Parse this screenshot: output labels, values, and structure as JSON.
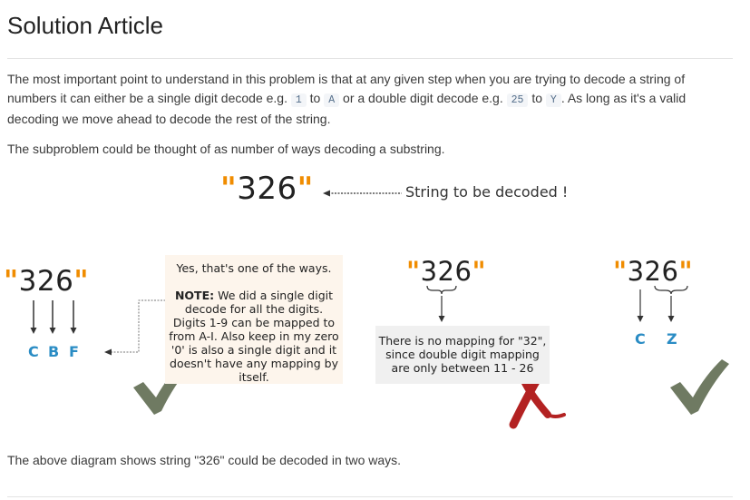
{
  "title": "Solution Article",
  "intro": {
    "text_a": "The most important point to understand in this problem is that at any given step when you are trying to decode a string of numbers it can either be a single digit decode e.g. ",
    "code_1": "1",
    "to_1": " to ",
    "code_2": "A",
    "text_b": " or a double digit decode e.g. ",
    "code_3": "25",
    "to_2": " to ",
    "code_4": "Y",
    "text_c": ". As long as it's a valid decoding we move ahead to decode the rest of the string."
  },
  "subproblem_text": "The subproblem could be thought of as number of ways decoding a substring.",
  "diagram": {
    "input_string": "326",
    "input_caption": "String to be decoded !",
    "left_string": "326",
    "left_letters": [
      "C",
      "B",
      "F"
    ],
    "note_first": "Yes, that's one of the ways.",
    "note_label": "NOTE:",
    "note_body": " We did a single digit decode for all the digits. Digits 1-9 can be mapped to from A-I. Also keep in my zero '0' is also a single digit and it doesn't have any mapping by itself.",
    "middle_string": "326",
    "middle_note": "There is no mapping for \"32\", since double digit mapping are only between 11 - 26",
    "right_string": "326",
    "right_letters": [
      "C",
      "Z"
    ],
    "colors": {
      "quote": "#f08c00",
      "letters": "#2a8cc4",
      "check": "#6f7a62",
      "cross": "#b32222"
    }
  },
  "conclusion_text": "The above diagram shows string \"326\" could be decoded in two ways."
}
